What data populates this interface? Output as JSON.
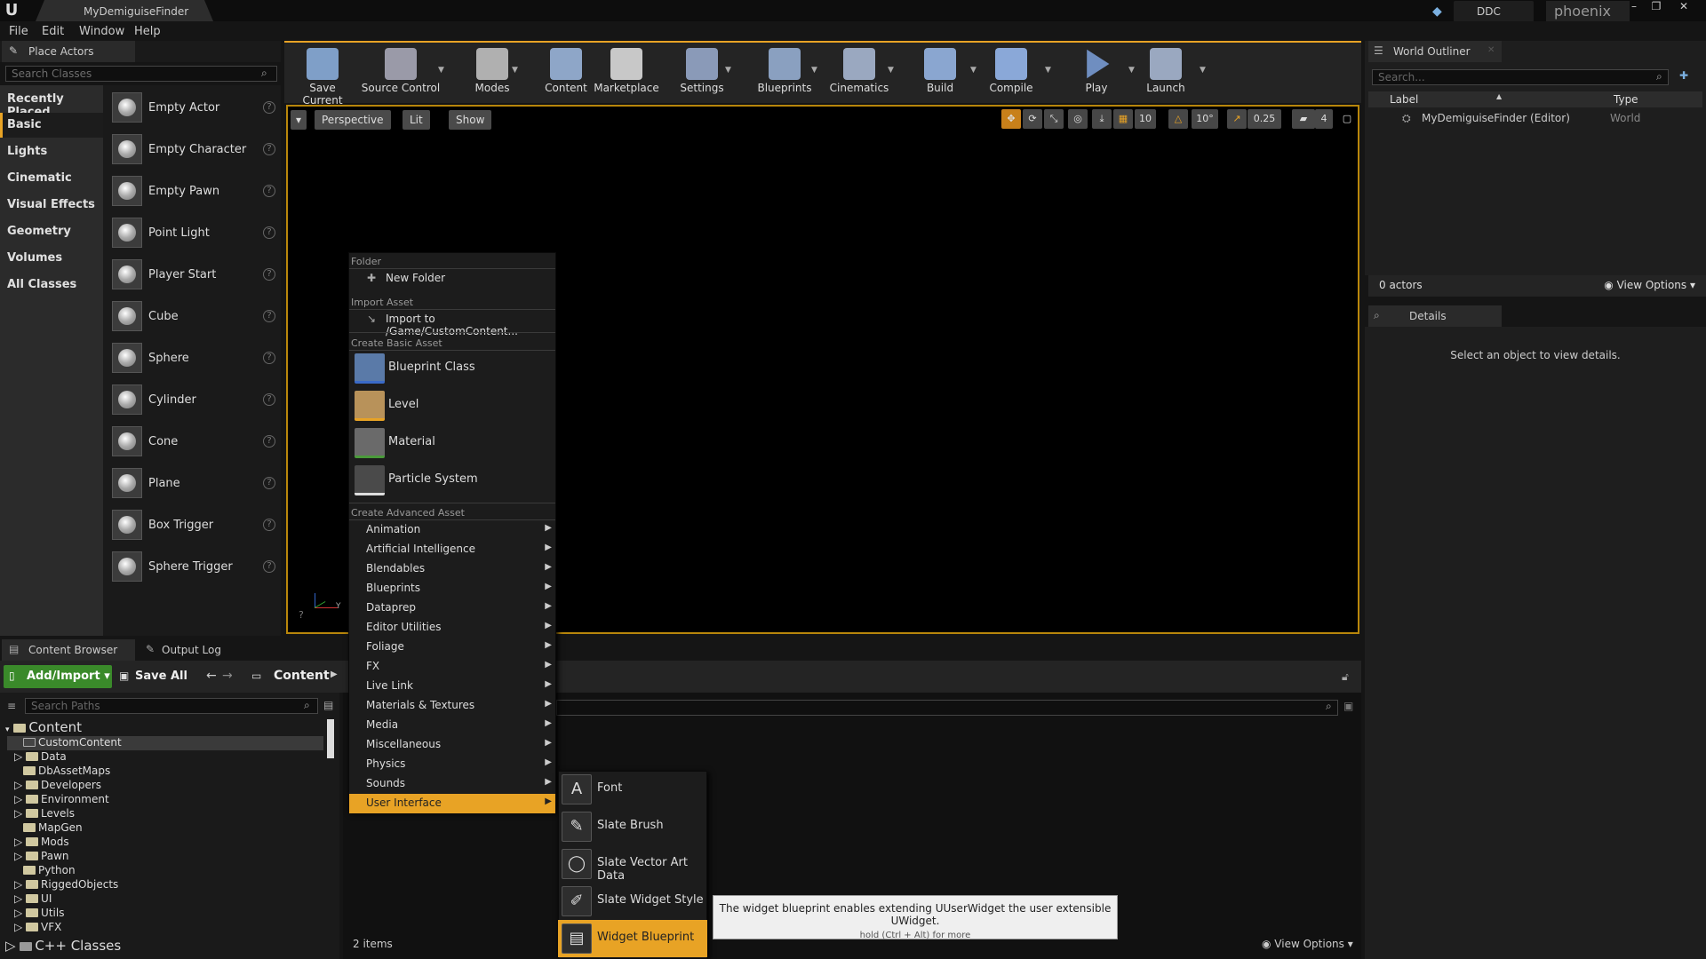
{
  "app": {
    "doc_tab": "MyDemiguiseFinder",
    "ddc_label": "DDC",
    "project": "phoenix"
  },
  "menu": [
    "File",
    "Edit",
    "Window",
    "Help"
  ],
  "place_actors": {
    "tab": "Place Actors",
    "search_placeholder": "Search Classes",
    "categories": [
      "Recently Placed",
      "Basic",
      "Lights",
      "Cinematic",
      "Visual Effects",
      "Geometry",
      "Volumes",
      "All Classes"
    ],
    "selected_category": "Basic",
    "actors": [
      "Empty Actor",
      "Empty Character",
      "Empty Pawn",
      "Point Light",
      "Player Start",
      "Cube",
      "Sphere",
      "Cylinder",
      "Cone",
      "Plane",
      "Box Trigger",
      "Sphere Trigger"
    ]
  },
  "toolbar": [
    "Save Current",
    "Source Control",
    "Modes",
    "Content",
    "Marketplace",
    "Settings",
    "Blueprints",
    "Cinematics",
    "Build",
    "Compile",
    "Play",
    "Launch"
  ],
  "viewport": {
    "perspective": "Perspective",
    "lit": "Lit",
    "show": "Show",
    "grid_snap": "10",
    "rot_snap": "10°",
    "scale_snap": "0.25",
    "cam_speed": "4"
  },
  "outliner": {
    "tab": "World Outliner",
    "search_placeholder": "Search...",
    "col_label": "Label",
    "col_type": "Type",
    "row_label": "MyDemiguiseFinder (Editor)",
    "row_type": "World",
    "actors_count": "0 actors",
    "view_options": "View Options"
  },
  "details": {
    "tab": "Details",
    "message": "Select an object to view details."
  },
  "content_browser": {
    "tab": "Content Browser",
    "output_tab": "Output Log",
    "add_import": "Add/Import",
    "save_all": "Save All",
    "breadcrumb": "Content",
    "search_paths_placeholder": "Search Paths",
    "root": "Content",
    "folders": [
      "CustomContent",
      "Data",
      "DbAssetMaps",
      "Developers",
      "Environment",
      "Levels",
      "MapGen",
      "Mods",
      "Pawn",
      "Python",
      "RiggedObjects",
      "UI",
      "Utils",
      "VFX"
    ],
    "cpp_classes": "C++ Classes",
    "items_count": "2 items",
    "view_options": "View Options"
  },
  "context_menu": {
    "folder_section": "Folder",
    "new_folder": "New Folder",
    "import_section": "Import Asset",
    "import_to": "Import to /Game/CustomContent...",
    "basic_section": "Create Basic Asset",
    "basic": [
      "Blueprint Class",
      "Level",
      "Material",
      "Particle System"
    ],
    "advanced_section": "Create Advanced Asset",
    "advanced": [
      "Animation",
      "Artificial Intelligence",
      "Blendables",
      "Blueprints",
      "Dataprep",
      "Editor Utilities",
      "Foliage",
      "FX",
      "Live Link",
      "Materials & Textures",
      "Media",
      "Miscellaneous",
      "Physics",
      "Sounds",
      "User Interface"
    ],
    "highlighted": "User Interface"
  },
  "submenu": {
    "items": [
      "Font",
      "Slate Brush",
      "Slate Vector Art Data",
      "Slate Widget Style",
      "Widget Blueprint"
    ],
    "highlighted": "Widget Blueprint"
  },
  "tooltip": {
    "text": "The widget blueprint enables extending UUserWidget the user extensible UWidget.",
    "hint": "hold (Ctrl + Alt) for more"
  },
  "colors": {
    "accent": "#e8a325",
    "add_button": "#3a8a2a",
    "background": "#151515"
  }
}
